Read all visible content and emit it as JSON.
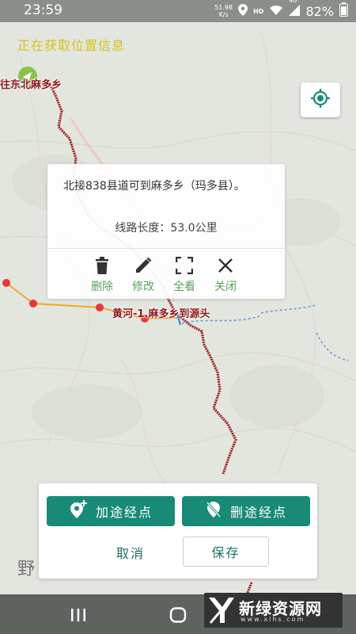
{
  "status_bar": {
    "time": "23:59",
    "net_speed_value": "51.98",
    "net_speed_unit": "K/s",
    "hd": "HD",
    "signal": "4G",
    "battery": "82%"
  },
  "map": {
    "location_status": "正在获取位置信息",
    "place_label": "往东北麻多乡",
    "route_label": "黄河-1.麻多乡到源头",
    "watermark_char": "野",
    "route_color": "#9b1b1b",
    "orange_route_color": "#f5a623",
    "marker_color": "#e53935"
  },
  "popup": {
    "description": "北接838县道可到麻多乡（玛多县）。",
    "length_text": "线路长度：53.0公里",
    "actions": [
      {
        "icon": "trash-icon",
        "label": "删除"
      },
      {
        "icon": "pencil-icon",
        "label": "修改"
      },
      {
        "icon": "fullscreen-icon",
        "label": "全看"
      },
      {
        "icon": "close-icon",
        "label": "关闭"
      }
    ],
    "accent_color": "#5aa35a"
  },
  "panel": {
    "add_waypoint": "加途经点",
    "remove_waypoint": "删途经点",
    "cancel": "取消",
    "save": "保存",
    "primary_color": "#1a8a78"
  },
  "watermark": {
    "title": "新绿资源网",
    "url": "www.xlhs.com"
  }
}
